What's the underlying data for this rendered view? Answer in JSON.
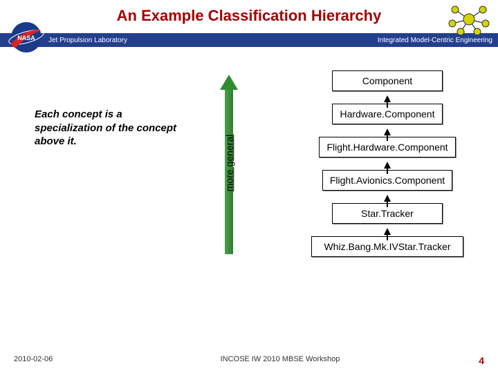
{
  "title": "An Example Classification Hierarchy",
  "header": {
    "left": "Jet Propulsion Laboratory",
    "right": "Integrated Model-Centric Engineering"
  },
  "caption": "Each concept is a specialization of the concept above it.",
  "arrow_label": "more general",
  "hierarchy": [
    "Component",
    "Hardware.Component",
    "Flight.Hardware.Component",
    "Flight.Avionics.Component",
    "Star.Tracker",
    "Whiz.Bang.Mk.IVStar.Tracker"
  ],
  "footer": {
    "date": "2010-02-06",
    "event": "INCOSE IW 2010 MBSE Workshop",
    "page": "4"
  }
}
